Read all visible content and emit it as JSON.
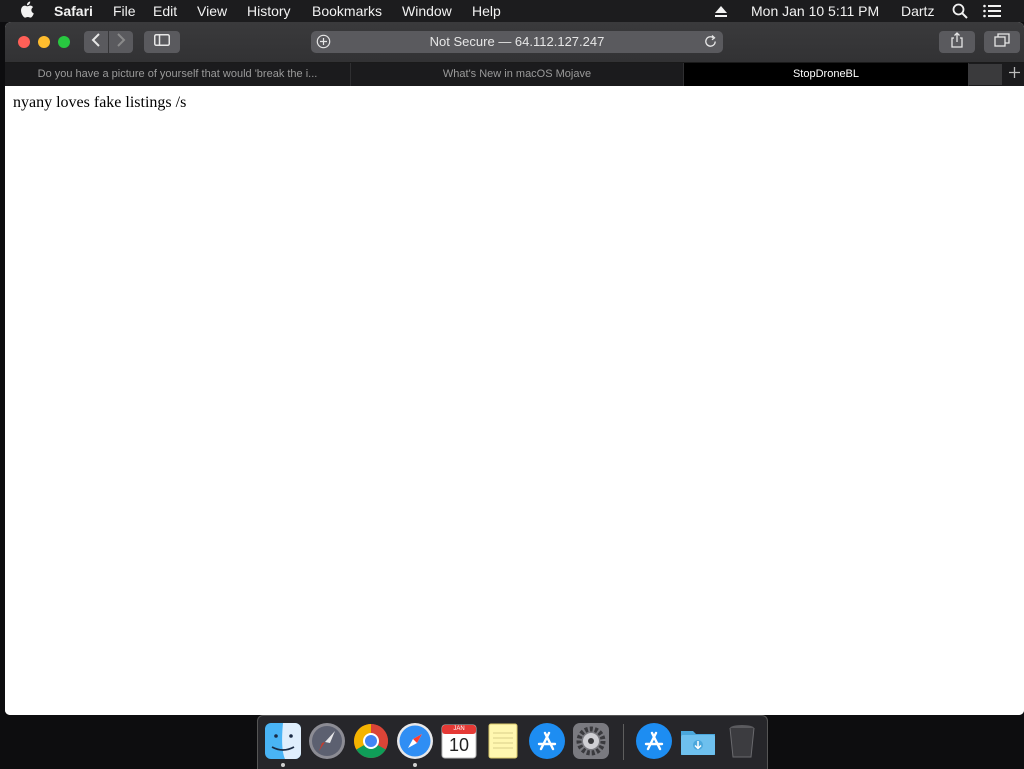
{
  "menubar": {
    "app_name": "Safari",
    "menus": [
      "File",
      "Edit",
      "View",
      "History",
      "Bookmarks",
      "Window",
      "Help"
    ],
    "clock": "Mon Jan 10  5:11 PM",
    "user": "Dartz",
    "icons": [
      "apple-icon",
      "eject-icon",
      "search-icon",
      "list-icon"
    ]
  },
  "toolbar": {
    "address_text": "Not Secure — 64.112.127.247"
  },
  "tabs": [
    {
      "title": "Do you have a picture of yourself that would 'break the i...",
      "active": false
    },
    {
      "title": "What's New in macOS Mojave",
      "active": false
    },
    {
      "title": "StopDroneBL",
      "active": true
    }
  ],
  "page": {
    "text": "nyany loves fake listings /s"
  },
  "dock": {
    "apps": [
      "Finder",
      "Launchpad",
      "Google Chrome",
      "Safari",
      "Calendar",
      "Notes",
      "App Store",
      "System Preferences",
      "App Store",
      "Downloads",
      "Trash"
    ],
    "calendar": {
      "month": "JAN",
      "day": "10"
    }
  },
  "colors": {
    "close": "#ff5f57",
    "minimize": "#febc2e",
    "zoom": "#28c840",
    "menubar_bg": "#1c1c1e",
    "toolbar_bg": "#3a3a3c"
  }
}
